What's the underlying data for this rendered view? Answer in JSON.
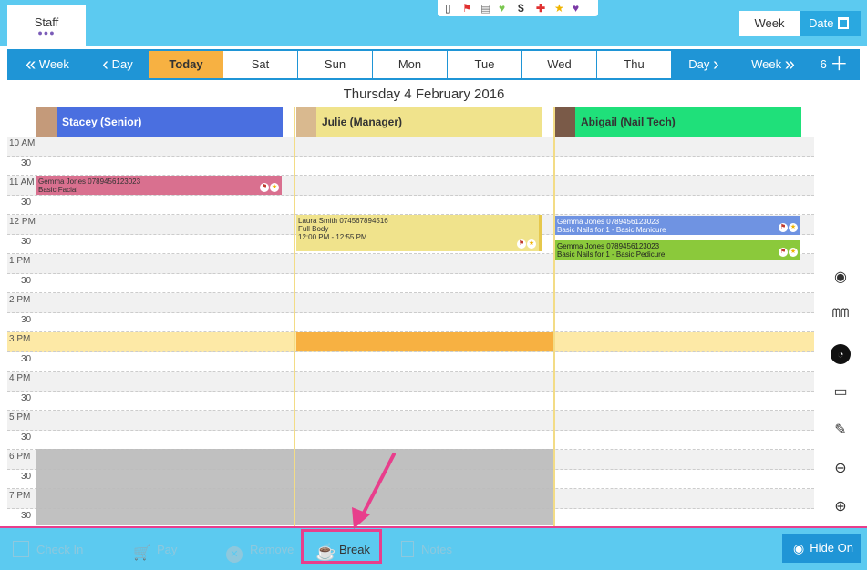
{
  "header": {
    "staff_tab_label": "Staff",
    "staff_tab_dots": "●●●",
    "view_toggle": {
      "week_label": "Week",
      "date_label": "Date"
    },
    "status_icons": [
      "phone-icon",
      "flag-icon",
      "document-icon",
      "heart-icon",
      "dollar-icon",
      "cross-icon",
      "star-icon",
      "broken-heart-icon"
    ]
  },
  "navigation": {
    "prev_week": "Week",
    "prev_day": "Day",
    "days": [
      "Today",
      "Sat",
      "Sun",
      "Mon",
      "Tue",
      "Wed",
      "Thu"
    ],
    "next_day": "Day",
    "next_week": "Week",
    "count": "6"
  },
  "date_title": "Thursday 4 February 2016",
  "staff": [
    {
      "name": "Stacey (Senior)",
      "color": "#4a6fe0"
    },
    {
      "name": "Julie (Manager)",
      "color": "#f0e38c"
    },
    {
      "name": "Abigail (Nail Tech)",
      "color": "#1fe07a"
    }
  ],
  "times": [
    "10 AM",
    "30",
    "11 AM",
    "30",
    "12 PM",
    "30",
    "1 PM",
    "30",
    "2 PM",
    "30",
    "3 PM",
    "30",
    "4 PM",
    "30",
    "5 PM",
    "30",
    "6 PM",
    "30",
    "7 PM",
    "30"
  ],
  "appointments": [
    {
      "line1": "Gemma Jones 0789456123023",
      "line2": "Basic Facial",
      "line3": ""
    },
    {
      "line1": "Laura Smith 074567894516",
      "line2": "Full Body",
      "line3": "12:00 PM - 12:55 PM"
    },
    {
      "line1": "Gemma Jones 0789456123023",
      "line2": "Basic Nails for 1 - Basic Manicure",
      "line3": ""
    },
    {
      "line1": "Gemma Jones 0789456123023",
      "line2": "Basic Nails for 1 - Basic Pedicure",
      "line3": ""
    }
  ],
  "side_tools": [
    "eye-icon",
    "teeth-icon",
    "clock-icon",
    "printer-icon",
    "notes-icon",
    "zoom-out-icon",
    "zoom-in-icon"
  ],
  "footer": {
    "check_in": "Check In",
    "pay": "Pay",
    "remove": "Remove",
    "break": "Break",
    "notes": "Notes",
    "hide_on": "Hide On"
  },
  "colors": {
    "topbar": "#5ccaf0",
    "navbar": "#1f95d6",
    "today": "#f7b142",
    "highlight": "#e83e8c"
  }
}
